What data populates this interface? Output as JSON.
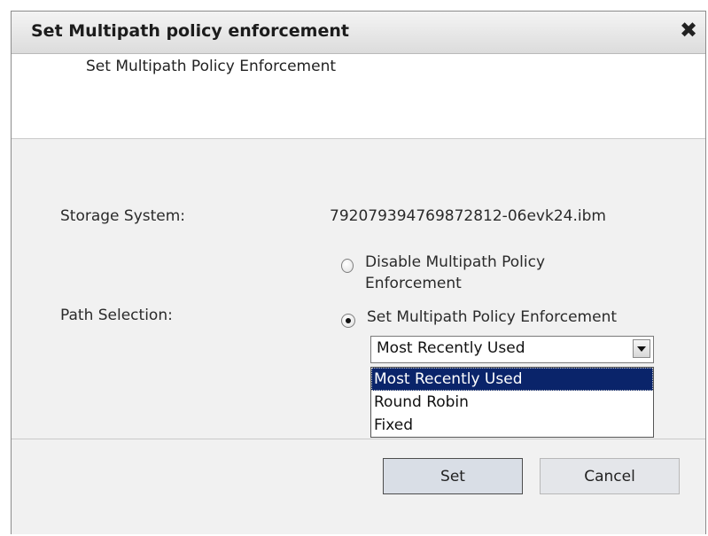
{
  "dialog": {
    "title": "Set Multipath policy enforcement",
    "close_glyph": "✖",
    "header_text": "Set Multipath Policy Enforcement"
  },
  "form": {
    "storage_label": "Storage System:",
    "storage_value": "792079394769872812-06evk24.ibm",
    "path_label": "Path Selection:",
    "radio_disable": "Disable Multipath Policy Enforcement",
    "radio_set": "Set Multipath Policy Enforcement",
    "selected_option": "Most Recently Used",
    "options": [
      "Most Recently Used",
      "Round Robin",
      "Fixed"
    ]
  },
  "buttons": {
    "set": "Set",
    "cancel": "Cancel"
  },
  "icons": {
    "close": "close-icon",
    "dropdown": "chevron-down-icon"
  },
  "colors": {
    "selection": "#0a246a",
    "dialog_bg": "#f1f1f1"
  }
}
